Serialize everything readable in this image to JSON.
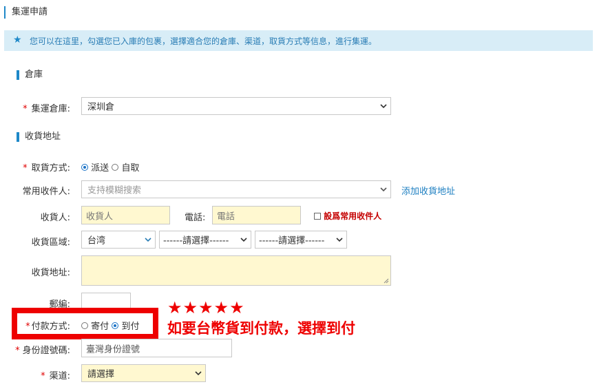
{
  "page": {
    "title": "集運申請",
    "notice": "您可以在這里，勾選您已入庫的包裹，選擇適合您的倉庫、渠道，取貨方式等信息，進行集運。"
  },
  "warehouse_section": {
    "heading": "倉庫",
    "warehouse_label": "集運倉庫:",
    "warehouse_value": "深圳倉"
  },
  "address_section": {
    "heading": "收貨地址",
    "pickup_label": "取貨方式:",
    "pickup_options": [
      "派送",
      "自取"
    ],
    "pickup_selected": "派送",
    "common_recipient_label": "常用收件人:",
    "common_recipient_placeholder": "支持模糊搜索",
    "add_address_link": "添加收貨地址",
    "recipient_label": "收貨人:",
    "recipient_placeholder": "收貨人",
    "phone_label": "電話:",
    "phone_placeholder": "電話",
    "set_common_label": "設爲常用收件人",
    "region_label": "收貨區域:",
    "region_country": "台湾",
    "region_select_2": "------請選擇------",
    "region_select_3": "------請選擇------",
    "address_label": "收貨地址:",
    "zip_label": "郵編:",
    "payment_label": "付款方式:",
    "payment_options": [
      "寄付",
      "到付"
    ],
    "payment_selected": "到付",
    "id_label": "身份證號碼:",
    "id_placeholder": "臺灣身份證號",
    "channel_label": "渠道:",
    "channel_value": "請選擇"
  },
  "annotation": {
    "stars": "★★★★★",
    "text": "如要台幣貨到付款，選擇到付"
  },
  "colors": {
    "accent": "#1e88c8",
    "notice_bg": "#d8edf7",
    "required": "#e00000",
    "input_yellow": "#fff8d0",
    "annotation_red": "#ee0000"
  }
}
